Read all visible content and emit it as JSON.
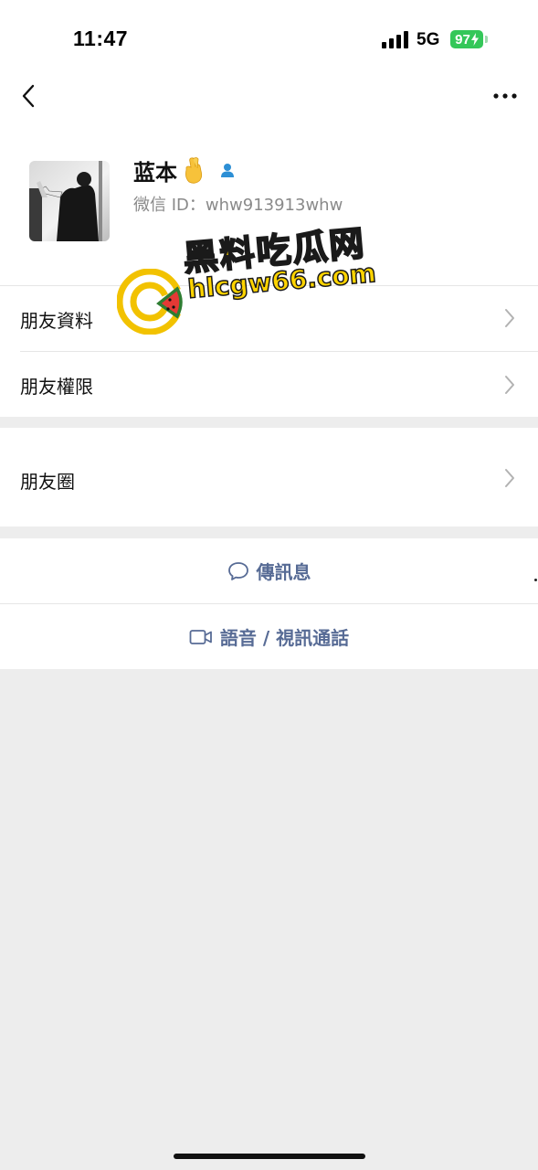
{
  "status_bar": {
    "time": "11:47",
    "network": "5G",
    "battery": "97"
  },
  "nav": {
    "back_icon": "chevron-left-icon",
    "more_icon": "ellipsis-icon"
  },
  "profile": {
    "nickname": "蓝本",
    "emoji": "crossed-fingers-icon",
    "contact_icon": "person-icon",
    "wechat_id": "微信 ID：whw913913whw"
  },
  "watermark": {
    "title": "黑料吃瓜网",
    "url": "hlcgw66.com"
  },
  "menu": {
    "friend_profile": "朋友資料",
    "friend_permissions": "朋友權限",
    "moments": "朋友圈"
  },
  "actions": {
    "message": "傳訊息",
    "message_icon": "chat-bubble-icon",
    "call": "語音 / 視訊通話",
    "call_icon": "video-camera-icon"
  },
  "colors": {
    "link": "#576b95",
    "background": "#ededed",
    "battery": "#34c759",
    "watermark_yellow": "#ffd400"
  }
}
